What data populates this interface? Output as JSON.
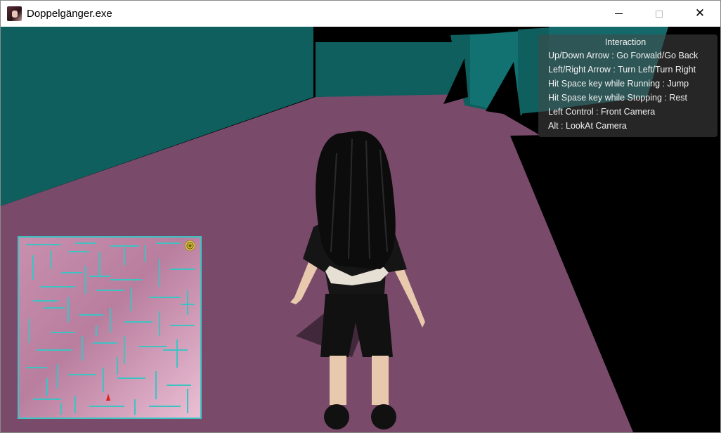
{
  "window": {
    "title": "Doppelgänger.exe",
    "controls": [
      "minimize-icon",
      "maximize-icon",
      "close-icon"
    ],
    "close_glyph": "✕"
  },
  "hud": {
    "title": "Interaction",
    "lines": [
      "Up/Down Arrow : Go Forwald/Go Back",
      "Left/Right Arrow : Turn Left/Turn Right",
      "Hit Space key while Running : Jump",
      "Hit Spase key while Stopping : Rest",
      "Left Control : Front Camera",
      "Alt : LookAt Camera"
    ]
  },
  "colors": {
    "floor": "#7a4a6a",
    "wall": "#0f5f5f",
    "wall_accent": "#127272",
    "shadow": "#000000",
    "minimap_border": "#3ec3c3",
    "minimap_walls": "#3ec3c3",
    "player_marker": "#e02020"
  },
  "icons": {
    "app": "doppelganger-app-icon",
    "goal": "goal-spiral-icon",
    "player": "player-marker-icon"
  }
}
